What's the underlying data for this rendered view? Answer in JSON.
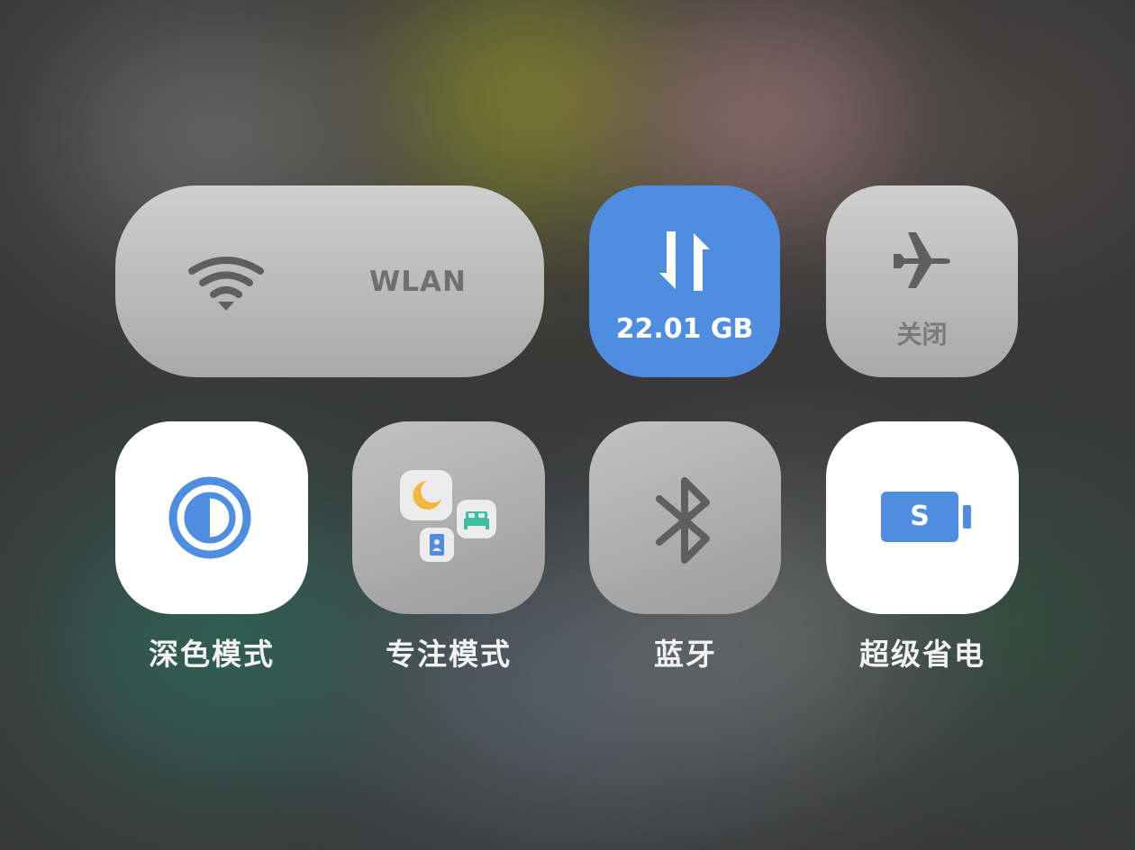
{
  "tiles": {
    "wlan": {
      "label": "WLAN",
      "icon": "wifi-icon",
      "state": "off"
    },
    "mobile_data": {
      "label": "22.01 GB",
      "icon": "mobile-data-icon",
      "state": "on",
      "color": "#4f8de0"
    },
    "airplane": {
      "label": "关闭",
      "icon": "airplane-icon",
      "state": "off"
    },
    "dark_mode": {
      "label": "深色模式",
      "icon": "dark-mode-icon",
      "state": "on",
      "color": "#4f8de0"
    },
    "focus_mode": {
      "label": "专注模式",
      "icon": "focus-mode-icon",
      "state": "off"
    },
    "bluetooth": {
      "label": "蓝牙",
      "icon": "bluetooth-icon",
      "state": "off"
    },
    "power_saver": {
      "label": "超级省电",
      "badge": "S",
      "icon": "battery-icon",
      "state": "on",
      "color": "#4f8de0"
    }
  },
  "colors": {
    "accent": "#4f8de0",
    "moon": "#f4b63c",
    "bed": "#3dbfa0",
    "contact_card": "#4f8de0"
  }
}
